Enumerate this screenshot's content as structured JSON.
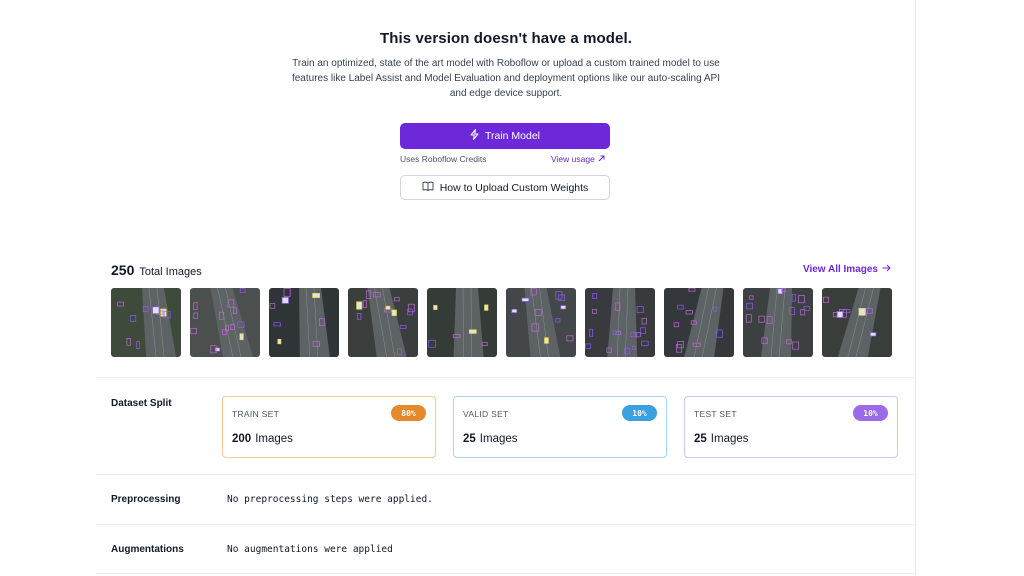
{
  "empty_state": {
    "title": "This version doesn't have a model.",
    "description": "Train an optimized, state of the art model with Roboflow or upload a custom trained model to use features like Label Assist and Model Evaluation and deployment options like our auto-scaling API and edge device support.",
    "train_button": "Train Model",
    "credits_note": "Uses Roboflow Credits",
    "view_usage": "View usage",
    "upload_button": "How to Upload Custom Weights"
  },
  "images": {
    "count": "250",
    "label": "Total Images",
    "view_all": "View All Images",
    "thumbnail_count": 10
  },
  "dataset_split": {
    "label": "Dataset Split",
    "sets": [
      {
        "name": "TRAIN SET",
        "percent": "80%",
        "count": "200",
        "unit": "Images",
        "color": "#e58a2c",
        "border": "#f5c79a"
      },
      {
        "name": "VALID SET",
        "percent": "10%",
        "count": "25",
        "unit": "Images",
        "color": "#3b9fe0",
        "border": "#a6d4f2"
      },
      {
        "name": "TEST SET",
        "percent": "10%",
        "count": "25",
        "unit": "Images",
        "color": "#9b6ae6",
        "border": "#d7c2f5"
      }
    ]
  },
  "preprocessing": {
    "label": "Preprocessing",
    "value": "No preprocessing steps were applied."
  },
  "augmentations": {
    "label": "Augmentations",
    "value": "No augmentations were applied"
  },
  "colors": {
    "accent": "#6d28d9"
  }
}
